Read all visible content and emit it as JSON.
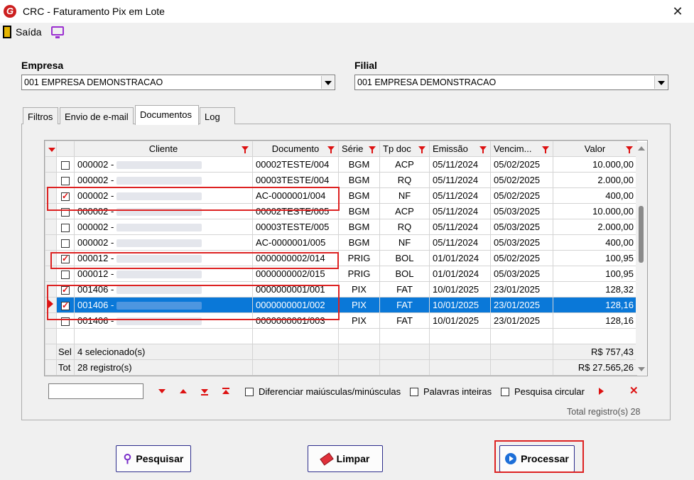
{
  "window": {
    "title": "CRC - Faturamento Pix em Lote",
    "logo": "G"
  },
  "toolbar": {
    "exit_label": "Saída"
  },
  "empresa": {
    "label": "Empresa",
    "value": "001 EMPRESA DEMONSTRACAO"
  },
  "filial": {
    "label": "Filial",
    "value": "001 EMPRESA DEMONSTRACAO"
  },
  "tabs": [
    {
      "label": "Filtros"
    },
    {
      "label": "Envio de e-mail"
    },
    {
      "label": "Documentos"
    },
    {
      "label": "Log"
    }
  ],
  "grid": {
    "columns": [
      "Cliente",
      "Documento",
      "Série",
      "Tp doc",
      "Emissão",
      "Vencim...",
      "Valor"
    ],
    "rows": [
      {
        "checked": false,
        "cliente": "000002 -",
        "documento": "00002TESTE/004",
        "serie": "BGM",
        "tpdoc": "ACP",
        "emissao": "05/11/2024",
        "vencimento": "05/02/2025",
        "valor": "10.000,00"
      },
      {
        "checked": false,
        "cliente": "000002 -",
        "documento": "00003TESTE/004",
        "serie": "BGM",
        "tpdoc": "RQ",
        "emissao": "05/11/2024",
        "vencimento": "05/02/2025",
        "valor": "2.000,00"
      },
      {
        "checked": true,
        "cliente": "000002 -",
        "documento": "AC-0000001/004",
        "serie": "BGM",
        "tpdoc": "NF",
        "emissao": "05/11/2024",
        "vencimento": "05/02/2025",
        "valor": "400,00"
      },
      {
        "checked": false,
        "cliente": "000002 -",
        "documento": "00002TESTE/005",
        "serie": "BGM",
        "tpdoc": "ACP",
        "emissao": "05/11/2024",
        "vencimento": "05/03/2025",
        "valor": "10.000,00"
      },
      {
        "checked": false,
        "cliente": "000002 -",
        "documento": "00003TESTE/005",
        "serie": "BGM",
        "tpdoc": "RQ",
        "emissao": "05/11/2024",
        "vencimento": "05/03/2025",
        "valor": "2.000,00"
      },
      {
        "checked": false,
        "cliente": "000002 -",
        "documento": "AC-0000001/005",
        "serie": "BGM",
        "tpdoc": "NF",
        "emissao": "05/11/2024",
        "vencimento": "05/03/2025",
        "valor": "400,00"
      },
      {
        "checked": true,
        "cliente": "000012 -",
        "documento": "0000000002/014",
        "serie": "PRIG",
        "tpdoc": "BOL",
        "emissao": "01/01/2024",
        "vencimento": "05/02/2025",
        "valor": "100,95"
      },
      {
        "checked": false,
        "cliente": "000012 -",
        "documento": "0000000002/015",
        "serie": "PRIG",
        "tpdoc": "BOL",
        "emissao": "01/01/2024",
        "vencimento": "05/03/2025",
        "valor": "100,95"
      },
      {
        "checked": true,
        "cliente": "001406 -",
        "documento": "0000000001/001",
        "serie": "PIX",
        "tpdoc": "FAT",
        "emissao": "10/01/2025",
        "vencimento": "23/01/2025",
        "valor": "128,32"
      },
      {
        "checked": true,
        "cliente": "001406 -",
        "documento": "0000000001/002",
        "serie": "PIX",
        "tpdoc": "FAT",
        "emissao": "10/01/2025",
        "vencimento": "23/01/2025",
        "valor": "128,16"
      },
      {
        "checked": false,
        "cliente": "001406 -",
        "documento": "0000000001/003",
        "serie": "PIX",
        "tpdoc": "FAT",
        "emissao": "10/01/2025",
        "vencimento": "23/01/2025",
        "valor": "128,16"
      }
    ],
    "footer": {
      "sel_label": "Sel",
      "sel_text": "4 selecionado(s)",
      "sel_total": "R$ 757,43",
      "tot_label": "Tot",
      "tot_text": "28 registro(s)",
      "tot_total": "R$ 27.565,26"
    }
  },
  "search": {
    "value": "",
    "option_case": "Diferenciar maiúsculas/minúsculas",
    "option_words": "Palavras inteiras",
    "option_circular": "Pesquisa circular"
  },
  "total_registros": "Total registro(s) 28",
  "buttons": {
    "pesquisar": "Pesquisar",
    "limpar": "Limpar",
    "processar": "Processar"
  }
}
